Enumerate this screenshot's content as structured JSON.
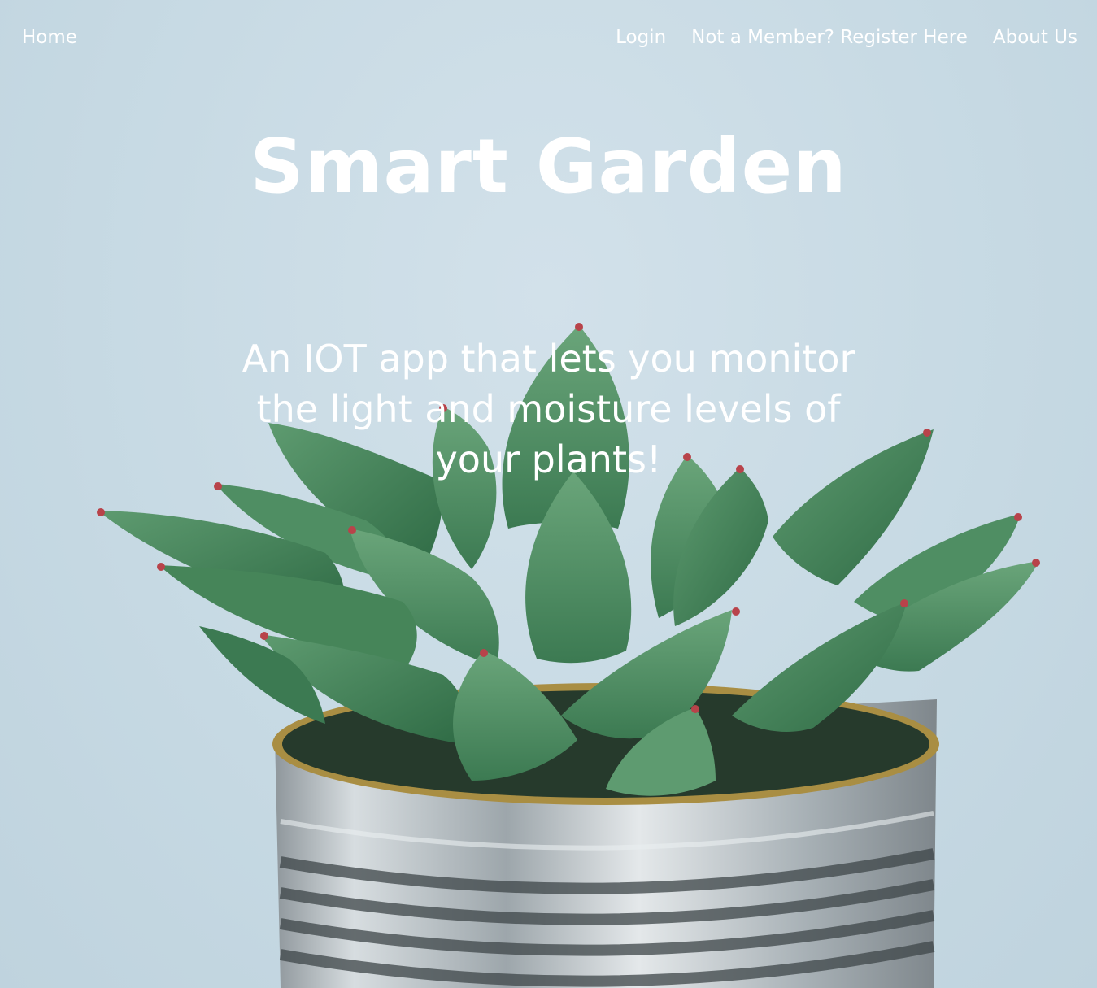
{
  "nav": {
    "home_label": "Home",
    "login_label": "Login",
    "register_label": "Not a Member? Register Here",
    "about_label": "About Us"
  },
  "hero": {
    "title": "Smart Garden",
    "tagline": "An IOT app that lets you monitor the light and moisture levels of your plants!",
    "image_subject": "succulent-in-tin-can"
  },
  "colors": {
    "background": "#c9dbe5",
    "text": "#ffffff",
    "leaf": "#4f8e63",
    "leaf_dark": "#2f6b45",
    "leaf_tip": "#b8434a",
    "tin": "#b9c2c8",
    "tin_rim": "#a98e43"
  }
}
